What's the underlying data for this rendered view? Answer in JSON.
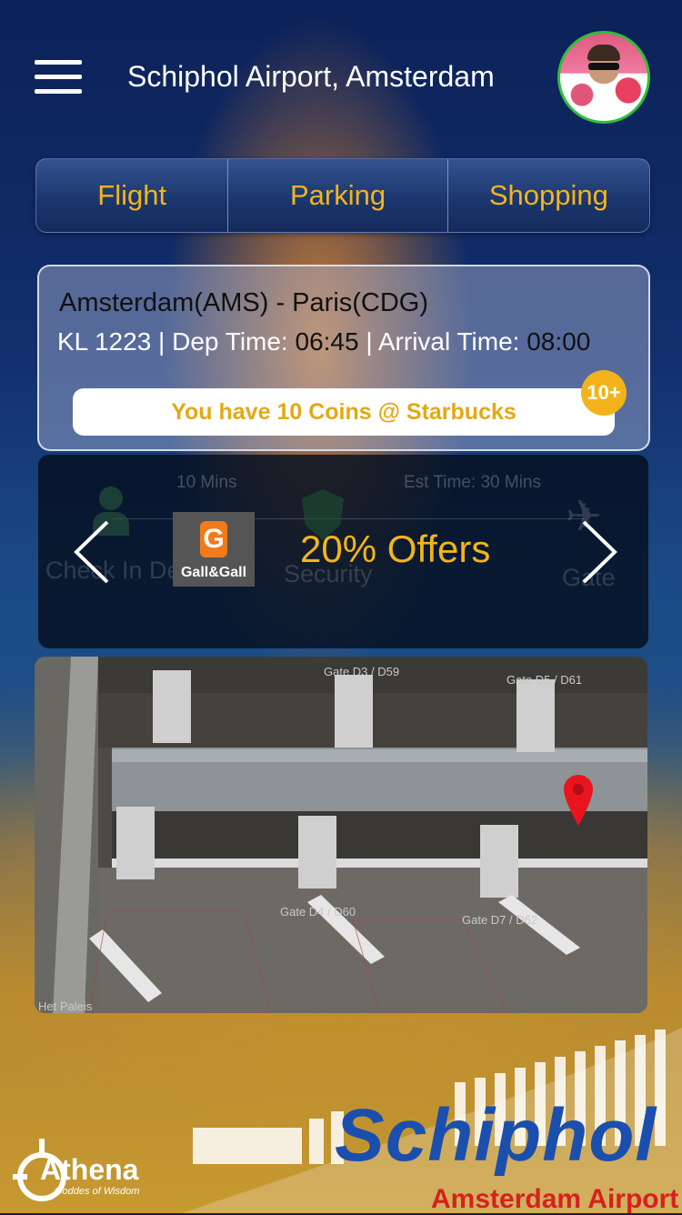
{
  "header": {
    "title": "Schiphol Airport, Amsterdam",
    "menu_icon": "hamburger-menu-icon",
    "avatar_icon": "user-avatar"
  },
  "tabs": [
    {
      "label": "Flight"
    },
    {
      "label": "Parking"
    },
    {
      "label": "Shopping"
    }
  ],
  "flight": {
    "route": "Amsterdam(AMS) - Paris(CDG)",
    "number_and_dep_label": "KL 1223 | Dep Time: ",
    "dep_time": "06:45",
    "arrival_label": " | Arrival Time: ",
    "arrival_time": "08:00",
    "coins_message": "You have 10 Coins @ Starbucks",
    "coins_badge": "10+"
  },
  "offers": {
    "background_labels": {
      "wait_1": "10 Mins",
      "wait_2": "Est Time: 30 Mins",
      "step_1": "Check In De",
      "step_2": "Security",
      "step_3": "Gate"
    },
    "brand_letter": "G",
    "brand_name": "Gall&Gall",
    "offer_text": "20% Offers"
  },
  "map": {
    "labels": [
      "Gate D3 / D59",
      "Gate D5 / D61",
      "Gate D4 / D60",
      "Gate D7 / D62",
      "Het Paleis"
    ],
    "pin_icon": "location-pin-icon"
  },
  "footer": {
    "athena": "Athena",
    "athena_tagline": "Goddes of Wisdom",
    "schiphol": "Schiphol",
    "schiphol_sub": "Amsterdam Airport"
  },
  "colors": {
    "accent": "#f2b51a",
    "pin": "#e8141e",
    "schiphol_blue": "#1b4fae",
    "schiphol_red": "#d7211e"
  }
}
